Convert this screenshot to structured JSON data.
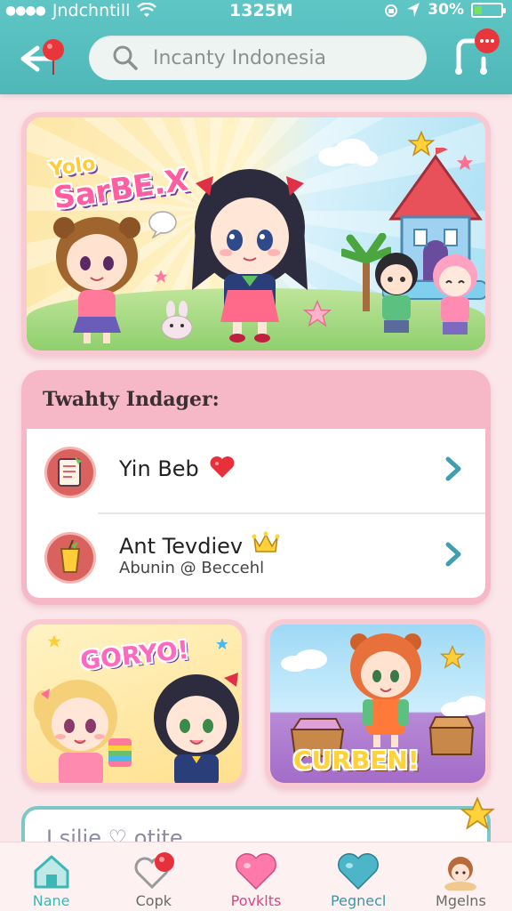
{
  "status_bar": {
    "signal_dots": "●●●●",
    "carrier": "Jndchntill",
    "time": "1325M",
    "battery_percent": "30%",
    "battery_level": 0.3
  },
  "header": {
    "back_icon": "back-arrow-icon",
    "search_placeholder": "Incanty Indonesia",
    "share_icon": "share-icon"
  },
  "banner": {
    "logo_text": "SarBE.X",
    "logo_top": "Yolo"
  },
  "list": {
    "title": "Twahty Indager:",
    "items": [
      {
        "name": "Yin Beb",
        "badge": "heart-icon",
        "subtitle": ""
      },
      {
        "name": "Ant Tevdiev",
        "badge": "crown-icon",
        "subtitle": "Abunin @ Beccеhl"
      }
    ]
  },
  "cards": [
    {
      "title": "GORYO!"
    },
    {
      "title": "CURBEN!"
    }
  ],
  "partial_card": {
    "text": "I silie  ♡  otite"
  },
  "bottom_nav": [
    {
      "label": "Nane",
      "icon": "home-icon",
      "active": true
    },
    {
      "label": "Copk",
      "icon": "heart-outline-icon",
      "active": false
    },
    {
      "label": "Povklts",
      "icon": "heart-icon",
      "active": false
    },
    {
      "label": "Pegnecl",
      "icon": "heart-teal-icon",
      "active": false
    },
    {
      "label": "Mgelns",
      "icon": "avatar-icon",
      "active": false
    }
  ],
  "colors": {
    "accent_teal": "#4fb7b8",
    "background_pink": "#fbe6ea",
    "card_border_pink": "#f6b8c7"
  }
}
